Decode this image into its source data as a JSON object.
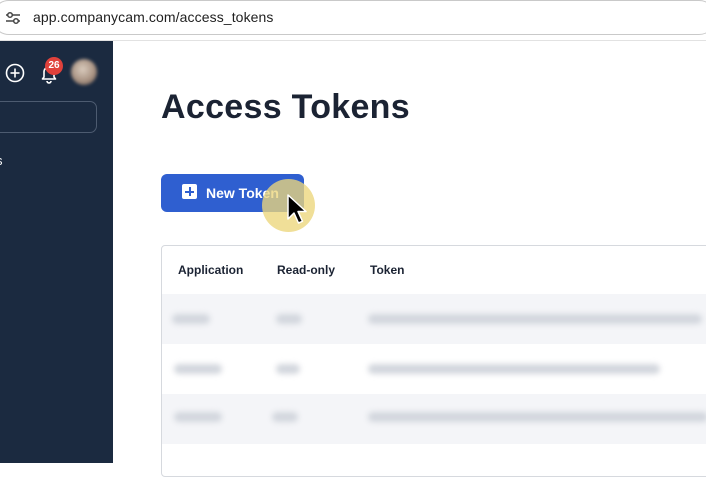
{
  "browser": {
    "url": "app.companycam.com/access_tokens",
    "site_icon": "site-settings-icon"
  },
  "sidebar": {
    "add_icon": "plus-circle-icon",
    "notifications_icon": "bell-icon",
    "notification_count": "26",
    "item_label": "s"
  },
  "main": {
    "title": "Access Tokens",
    "new_token_button": "New Token",
    "new_token_icon": "plus-square-icon"
  },
  "table": {
    "columns": [
      "Application",
      "Read-only",
      "Token"
    ],
    "rows_visible": 3,
    "row_content": "redacted"
  },
  "colors": {
    "sidebar_bg": "#1b2a40",
    "primary_button": "#2f5fd0",
    "badge": "#e0413b",
    "title_text": "#1b2333"
  }
}
